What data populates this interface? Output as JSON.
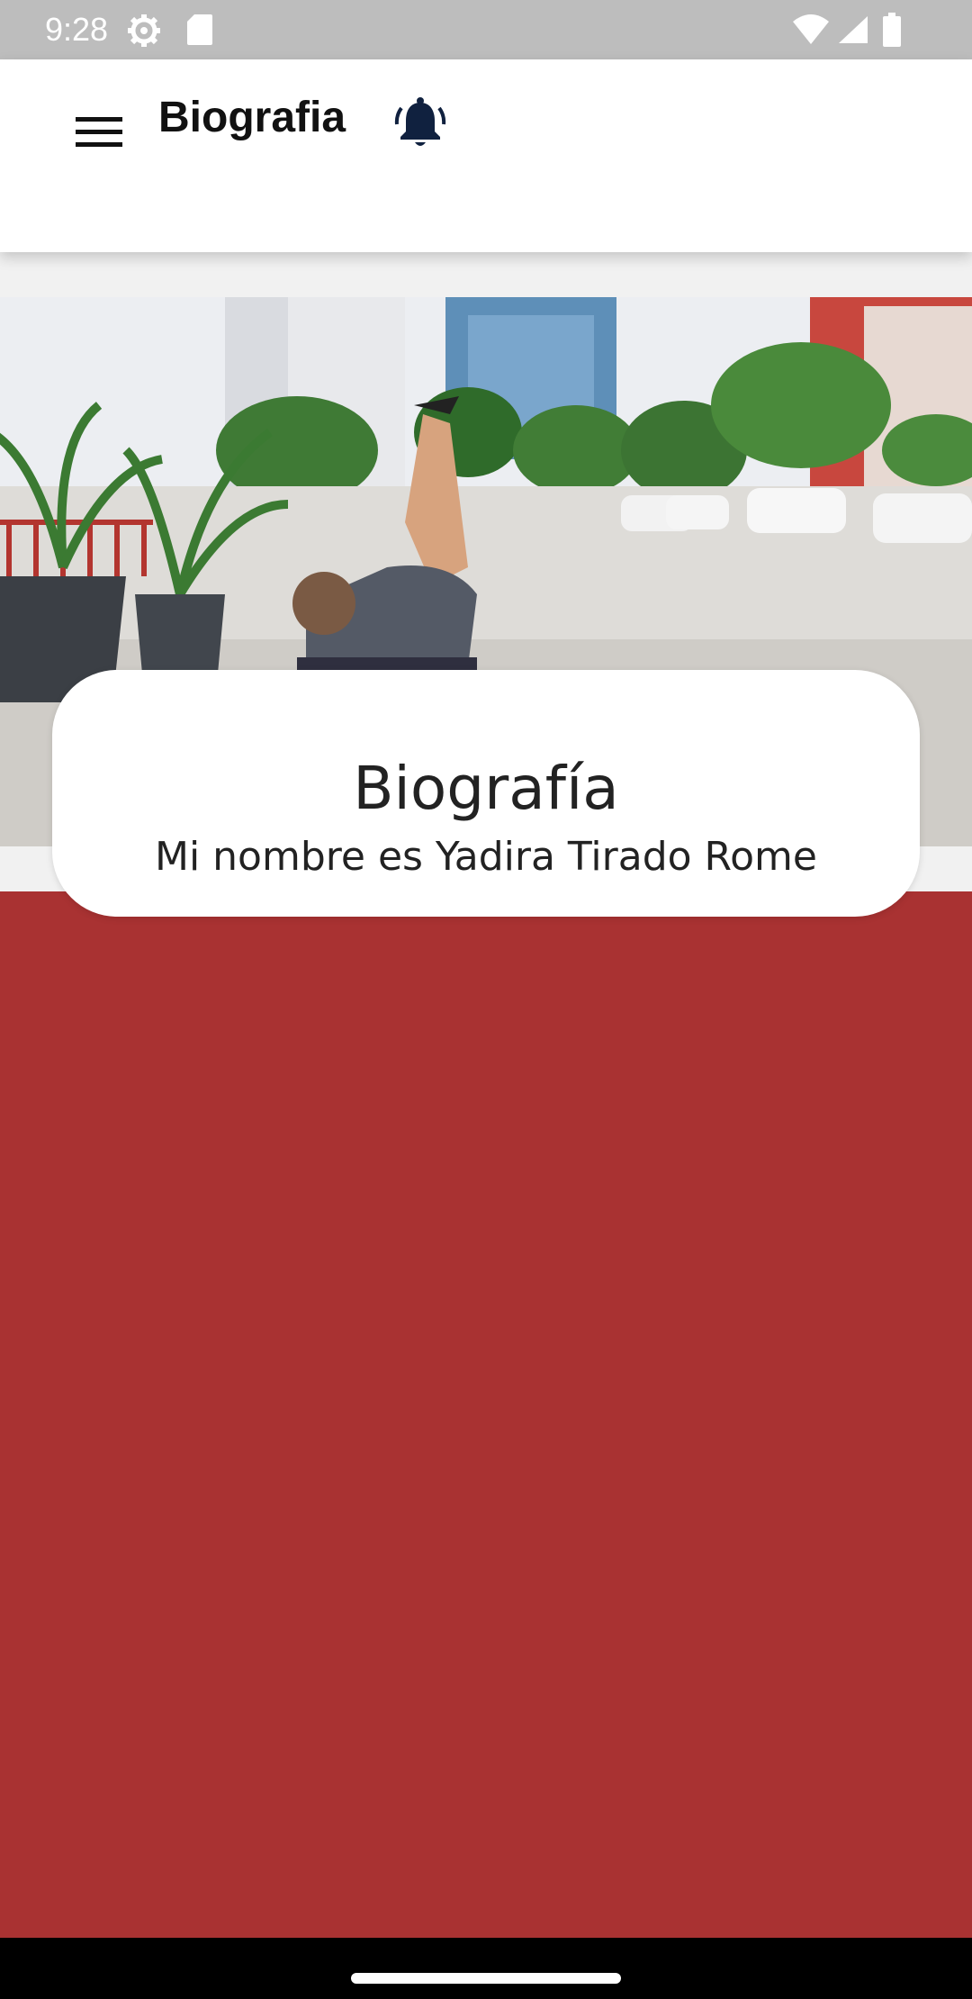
{
  "status_bar": {
    "time": "9:28",
    "icons": [
      "gear-icon",
      "sd-card-icon",
      "wifi-icon",
      "signal-icon",
      "battery-icon"
    ]
  },
  "app_bar": {
    "title": "Biografia",
    "menu_icon": "hamburger-menu-icon",
    "bell_icon": "notification-bell-icon"
  },
  "hero": {
    "image": "hero-photo"
  },
  "bio_card": {
    "title": "Biografía",
    "text": "Mi nombre es Yadira Tirado Rome"
  },
  "colors": {
    "status_bar": "#bdbdbd",
    "content_background": "#a93232",
    "card_background": "#ffffff",
    "bell_color": "#10213f"
  }
}
